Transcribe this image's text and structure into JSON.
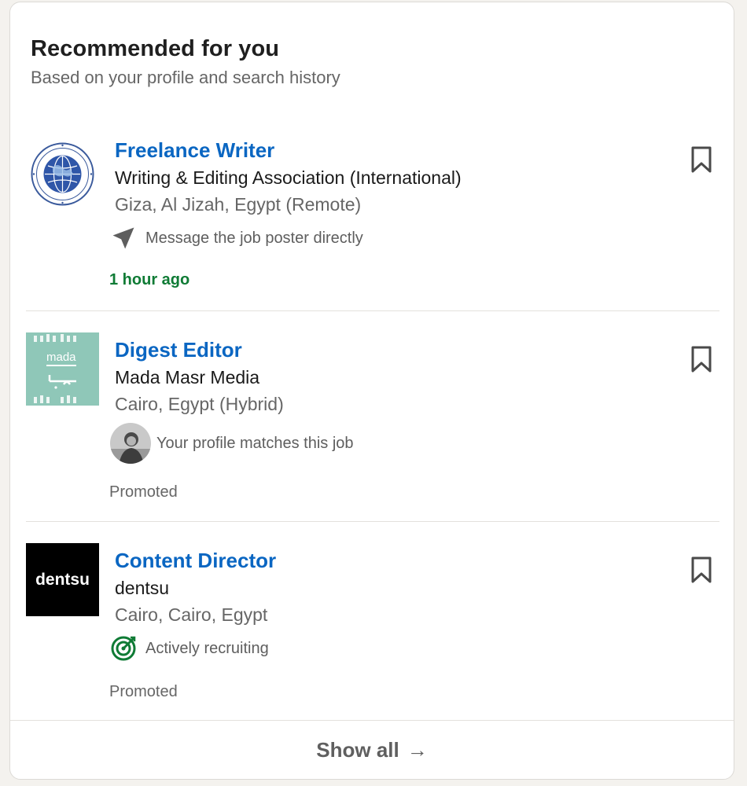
{
  "header": {
    "title": "Recommended for you",
    "subtitle": "Based on your profile and search history"
  },
  "jobs": [
    {
      "title": "Freelance Writer",
      "company": "Writing & Editing Association (International)",
      "location": "Giza, Al Jizah, Egypt (Remote)",
      "insight": "Message the job poster directly",
      "insight_icon": "send-icon",
      "meta": "1 hour ago",
      "logo": "globe-seal-logo"
    },
    {
      "title": "Digest Editor",
      "company": "Mada Masr Media",
      "location": "Cairo, Egypt (Hybrid)",
      "insight": "Your profile matches this job",
      "insight_icon": "profile-avatar",
      "meta": "Promoted",
      "logo": "mada-logo",
      "logo_text": "mada"
    },
    {
      "title": "Content Director",
      "company": "dentsu",
      "location": "Cairo, Cairo, Egypt",
      "insight": "Actively recruiting",
      "insight_icon": "target-icon",
      "meta": "Promoted",
      "logo": "dentsu-logo",
      "logo_text": "dentsu"
    }
  ],
  "footer": {
    "show_all": "Show all",
    "arrow": "→"
  },
  "colors": {
    "link": "#0a66c2",
    "fresh": "#0f7b35",
    "mada_bg": "#8fc7b8",
    "dentsu_bg": "#000000"
  }
}
